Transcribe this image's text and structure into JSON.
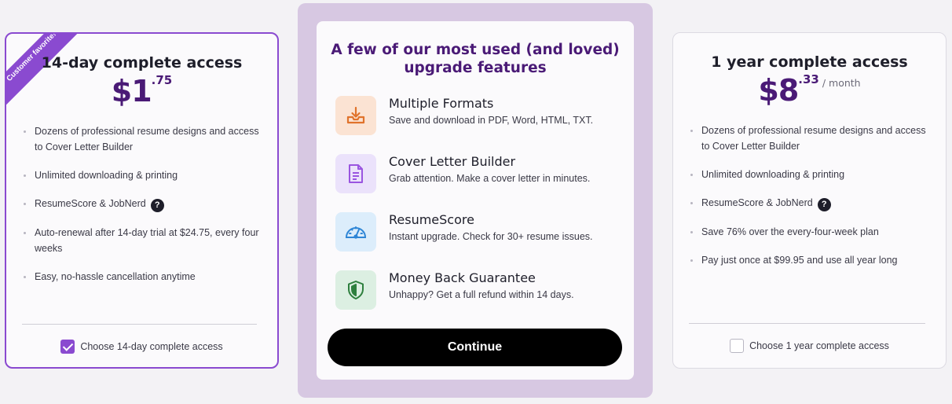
{
  "left_plan": {
    "ribbon": "Customer favorite!",
    "title": "14-day complete access",
    "price_dollar": "$1",
    "price_cents": ".75",
    "features": [
      "Dozens of professional resume designs and access to Cover Letter Builder",
      "Unlimited downloading & printing",
      "ResumeScore & JobNerd",
      "Auto-renewal after 14-day trial at $24.75, every four weeks",
      "Easy, no-hassle cancellation anytime"
    ],
    "help_icon": "?",
    "choose_label": "Choose 14-day complete access",
    "checked": true
  },
  "middle": {
    "title_line1": "A few of our most used (and loved)",
    "title_line2": "upgrade features",
    "features": [
      {
        "name": "Multiple Formats",
        "desc": "Save and download in PDF, Word, HTML, TXT.",
        "icon": "download-icon",
        "bg": "#fbe3d3",
        "color": "#e0732c"
      },
      {
        "name": "Cover Letter Builder",
        "desc": "Grab attention. Make a cover letter in minutes.",
        "icon": "document-icon",
        "bg": "#ebe2fb",
        "color": "#9a55e0"
      },
      {
        "name": "ResumeScore",
        "desc": "Instant upgrade. Check for 30+ resume issues.",
        "icon": "gauge-icon",
        "bg": "#dcedfb",
        "color": "#2f86d6"
      },
      {
        "name": "Money Back Guarantee",
        "desc": "Unhappy? Get a full refund within 14 days.",
        "icon": "shield-icon",
        "bg": "#dcefe2",
        "color": "#2e7f3e"
      }
    ],
    "continue_label": "Continue"
  },
  "right_plan": {
    "title": "1 year complete access",
    "price_dollar": "$8",
    "price_cents": ".33",
    "price_per": "/ month",
    "features": [
      "Dozens of professional resume designs and access to Cover Letter Builder",
      "Unlimited downloading & printing",
      "ResumeScore & JobNerd",
      "Save 76% over the every-four-week plan",
      "Pay just once at $99.95 and use all year long"
    ],
    "help_icon": "?",
    "choose_label": "Choose 1 year complete access",
    "checked": false
  }
}
